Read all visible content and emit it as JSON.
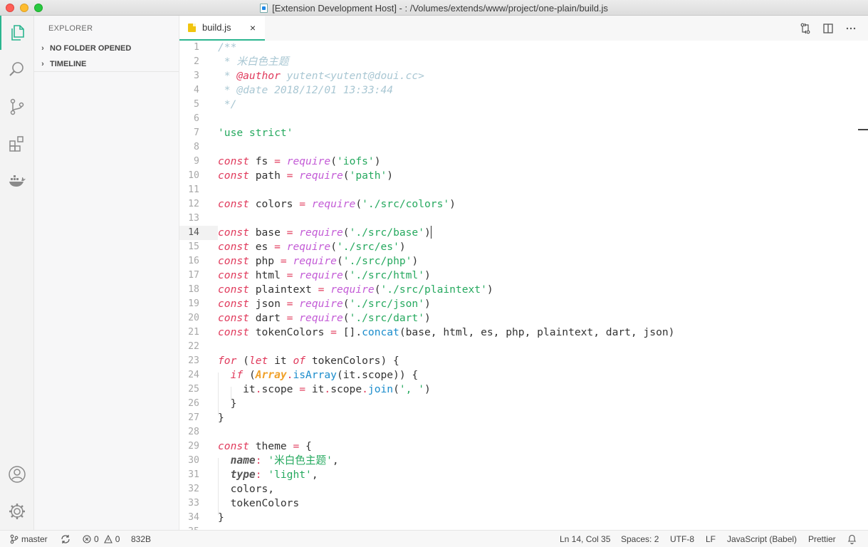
{
  "window": {
    "title": "[Extension Development Host] - : /Volumes/extends/www/project/one-plain/build.js"
  },
  "activity_bar": {
    "items": [
      "files-icon",
      "search-icon",
      "source-control-icon",
      "extensions-icon",
      "docker-icon"
    ],
    "bottom": [
      "account-icon",
      "gear-icon"
    ],
    "accent": "#2bb58f"
  },
  "sidebar": {
    "title": "EXPLORER",
    "sections": [
      {
        "label": "NO FOLDER OPENED"
      },
      {
        "label": "TIMELINE"
      }
    ]
  },
  "tabs": [
    {
      "label": "build.js",
      "close": "×"
    }
  ],
  "editor": {
    "current_line": 14,
    "lines": [
      [
        [
          "/**",
          "cm"
        ]
      ],
      [
        [
          " * 米白色主题",
          "cm"
        ]
      ],
      [
        [
          " * ",
          "cm"
        ],
        [
          "@author",
          "tag"
        ],
        [
          " yutent<yutent@doui.cc>",
          "cm"
        ]
      ],
      [
        [
          " * @date 2018/12/01 13:33:44",
          "cm"
        ]
      ],
      [
        [
          " */",
          "cm"
        ]
      ],
      [],
      [
        [
          "'use strict'",
          "str"
        ]
      ],
      [],
      [
        [
          "const",
          "kw"
        ],
        [
          " fs ",
          "id"
        ],
        [
          "=",
          "op"
        ],
        [
          " ",
          "id"
        ],
        [
          "require",
          "fn"
        ],
        [
          "(",
          "punc"
        ],
        [
          "'iofs'",
          "str"
        ],
        [
          ")",
          "punc"
        ]
      ],
      [
        [
          "const",
          "kw"
        ],
        [
          " path ",
          "id"
        ],
        [
          "=",
          "op"
        ],
        [
          " ",
          "id"
        ],
        [
          "require",
          "fn"
        ],
        [
          "(",
          "punc"
        ],
        [
          "'path'",
          "str"
        ],
        [
          ")",
          "punc"
        ]
      ],
      [],
      [
        [
          "const",
          "kw"
        ],
        [
          " colors ",
          "id"
        ],
        [
          "=",
          "op"
        ],
        [
          " ",
          "id"
        ],
        [
          "require",
          "fn"
        ],
        [
          "(",
          "punc"
        ],
        [
          "'./src/colors'",
          "str"
        ],
        [
          ")",
          "punc"
        ]
      ],
      [],
      [
        [
          "const",
          "kw"
        ],
        [
          " base ",
          "id"
        ],
        [
          "=",
          "op"
        ],
        [
          " ",
          "id"
        ],
        [
          "require",
          "fn"
        ],
        [
          "(",
          "punc"
        ],
        [
          "'./src/base'",
          "str"
        ],
        [
          ")",
          "punc"
        ]
      ],
      [
        [
          "const",
          "kw"
        ],
        [
          " es ",
          "id"
        ],
        [
          "=",
          "op"
        ],
        [
          " ",
          "id"
        ],
        [
          "require",
          "fn"
        ],
        [
          "(",
          "punc"
        ],
        [
          "'./src/es'",
          "str"
        ],
        [
          ")",
          "punc"
        ]
      ],
      [
        [
          "const",
          "kw"
        ],
        [
          " php ",
          "id"
        ],
        [
          "=",
          "op"
        ],
        [
          " ",
          "id"
        ],
        [
          "require",
          "fn"
        ],
        [
          "(",
          "punc"
        ],
        [
          "'./src/php'",
          "str"
        ],
        [
          ")",
          "punc"
        ]
      ],
      [
        [
          "const",
          "kw"
        ],
        [
          " html ",
          "id"
        ],
        [
          "=",
          "op"
        ],
        [
          " ",
          "id"
        ],
        [
          "require",
          "fn"
        ],
        [
          "(",
          "punc"
        ],
        [
          "'./src/html'",
          "str"
        ],
        [
          ")",
          "punc"
        ]
      ],
      [
        [
          "const",
          "kw"
        ],
        [
          " plaintext ",
          "id"
        ],
        [
          "=",
          "op"
        ],
        [
          " ",
          "id"
        ],
        [
          "require",
          "fn"
        ],
        [
          "(",
          "punc"
        ],
        [
          "'./src/plaintext'",
          "str"
        ],
        [
          ")",
          "punc"
        ]
      ],
      [
        [
          "const",
          "kw"
        ],
        [
          " json ",
          "id"
        ],
        [
          "=",
          "op"
        ],
        [
          " ",
          "id"
        ],
        [
          "require",
          "fn"
        ],
        [
          "(",
          "punc"
        ],
        [
          "'./src/json'",
          "str"
        ],
        [
          ")",
          "punc"
        ]
      ],
      [
        [
          "const",
          "kw"
        ],
        [
          " dart ",
          "id"
        ],
        [
          "=",
          "op"
        ],
        [
          " ",
          "id"
        ],
        [
          "require",
          "fn"
        ],
        [
          "(",
          "punc"
        ],
        [
          "'./src/dart'",
          "str"
        ],
        [
          ")",
          "punc"
        ]
      ],
      [
        [
          "const",
          "kw"
        ],
        [
          " tokenColors ",
          "id"
        ],
        [
          "=",
          "op"
        ],
        [
          " [].",
          "punc"
        ],
        [
          "concat",
          "meth"
        ],
        [
          "(base, html, es, php, plaintext, dart, json)",
          "punc"
        ]
      ],
      [],
      [
        [
          "for",
          "kw"
        ],
        [
          " (",
          "punc"
        ],
        [
          "let",
          "kw"
        ],
        [
          " it ",
          "id"
        ],
        [
          "of",
          "kw"
        ],
        [
          " tokenColors) {",
          "id"
        ]
      ],
      [
        [
          "  ",
          "id"
        ],
        [
          "if",
          "kw"
        ],
        [
          " (",
          "punc"
        ],
        [
          "Array",
          "cls"
        ],
        [
          ".",
          "dot"
        ],
        [
          "isArray",
          "meth"
        ],
        [
          "(it.scope)) {",
          "punc"
        ]
      ],
      [
        [
          "    it",
          "id"
        ],
        [
          ".",
          "dot"
        ],
        [
          "scope ",
          "id"
        ],
        [
          "=",
          "op"
        ],
        [
          " it",
          "id"
        ],
        [
          ".",
          "dot"
        ],
        [
          "scope",
          "id"
        ],
        [
          ".",
          "dot"
        ],
        [
          "join",
          "meth"
        ],
        [
          "(",
          "punc"
        ],
        [
          "', '",
          "str"
        ],
        [
          ")",
          "punc"
        ]
      ],
      [
        [
          "  }",
          "punc"
        ]
      ],
      [
        [
          "}",
          "punc"
        ]
      ],
      [],
      [
        [
          "const",
          "kw"
        ],
        [
          " theme ",
          "id"
        ],
        [
          "=",
          "op"
        ],
        [
          " {",
          "punc"
        ]
      ],
      [
        [
          "  ",
          "id"
        ],
        [
          "name",
          "prop"
        ],
        [
          ":",
          "op"
        ],
        [
          " ",
          "id"
        ],
        [
          "'米白色主题'",
          "str"
        ],
        [
          ",",
          "punc"
        ]
      ],
      [
        [
          "  ",
          "id"
        ],
        [
          "type",
          "prop"
        ],
        [
          ":",
          "op"
        ],
        [
          " ",
          "id"
        ],
        [
          "'light'",
          "str"
        ],
        [
          ",",
          "punc"
        ]
      ],
      [
        [
          "  colors,",
          "id"
        ]
      ],
      [
        [
          "  tokenColors",
          "id"
        ]
      ],
      [
        [
          "}",
          "punc"
        ]
      ],
      []
    ],
    "last_partial_line_number": "35"
  },
  "status": {
    "branch": "master",
    "errors": "0",
    "warnings": "0",
    "size": "832B",
    "position": "Ln 14, Col 35",
    "spaces": "Spaces: 2",
    "encoding": "UTF-8",
    "eol": "LF",
    "language": "JavaScript (Babel)",
    "formatter": "Prettier"
  }
}
